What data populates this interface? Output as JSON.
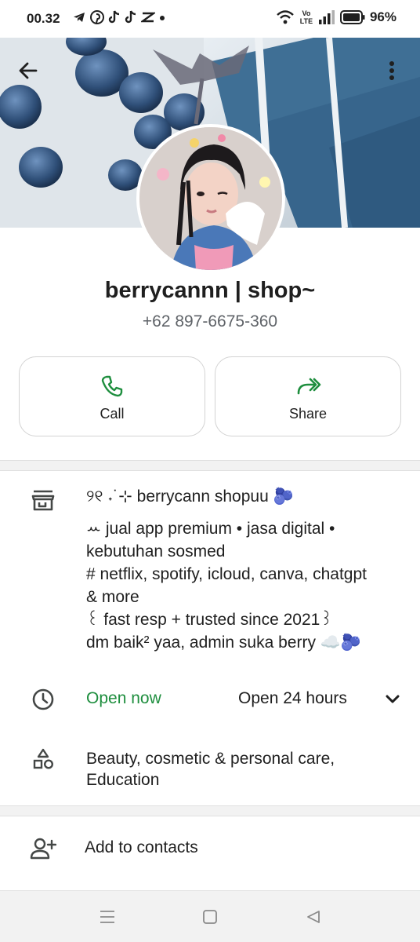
{
  "status_bar": {
    "time": "00.32",
    "battery": "96%",
    "network": "Vo LTE",
    "app_icons": [
      "telegram-icon",
      "pinterest-icon",
      "tiktok-icon",
      "tiktok-icon",
      "capcut-icon",
      "dot-icon"
    ]
  },
  "profile": {
    "name": "berrycannn | shop~",
    "phone": "+62 897-6675-360"
  },
  "actions": {
    "call_label": "Call",
    "share_label": "Share"
  },
  "about": {
    "lines": [
      "୨୧ ˖˙⊹ berrycann shopuu 🫐",
      "ꕀ jual app premium • jasa digital •",
      "kebutuhan sosmed",
      "# netflix, spotify, icloud, canva, chatgpt",
      "& more",
      "꒰ fast resp + trusted since 2021꒱",
      "dm baik² yaa, admin suka berry ☁️🫐"
    ]
  },
  "hours": {
    "status": "Open now",
    "detail": "Open 24 hours"
  },
  "category": {
    "text": "Beauty, cosmetic & personal care, Education"
  },
  "contact": {
    "add_label": "Add to contacts"
  },
  "colors": {
    "accent_green": "#1e8e3e",
    "text_primary": "#1f1f1f",
    "text_secondary": "#5f6368",
    "cover_blue": "#3f6f95"
  }
}
